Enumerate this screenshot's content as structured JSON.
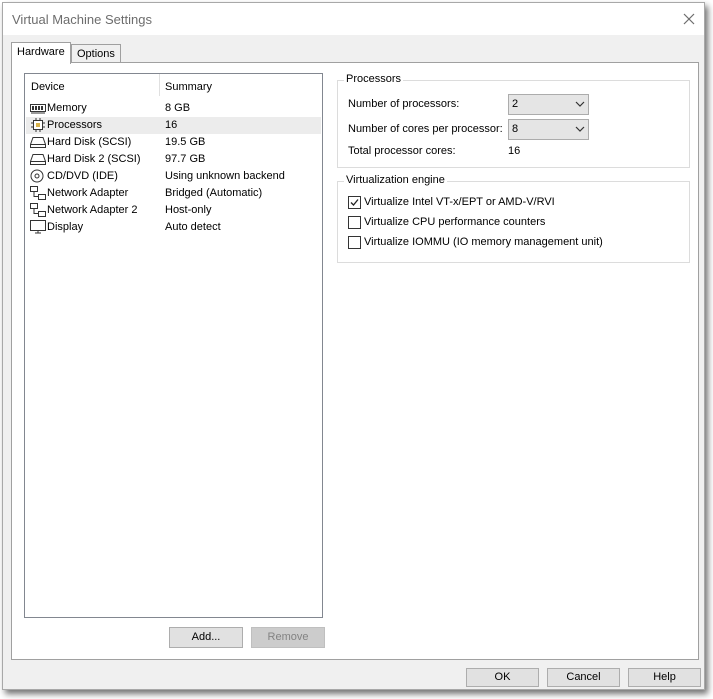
{
  "window": {
    "title": "Virtual Machine Settings"
  },
  "tabs": [
    {
      "label": "Hardware",
      "active": true
    },
    {
      "label": "Options",
      "active": false
    }
  ],
  "device_list": {
    "headers": {
      "device": "Device",
      "summary": "Summary"
    },
    "items": [
      {
        "icon": "memory-icon",
        "name": "Memory",
        "summary": "8 GB"
      },
      {
        "icon": "processor-icon",
        "name": "Processors",
        "summary": "16",
        "selected": true
      },
      {
        "icon": "hard-disk-icon",
        "name": "Hard Disk (SCSI)",
        "summary": "19.5 GB"
      },
      {
        "icon": "hard-disk-icon",
        "name": "Hard Disk 2 (SCSI)",
        "summary": "97.7 GB"
      },
      {
        "icon": "cd-dvd-icon",
        "name": "CD/DVD (IDE)",
        "summary": "Using unknown backend"
      },
      {
        "icon": "network-adapter-icon",
        "name": "Network Adapter",
        "summary": "Bridged (Automatic)"
      },
      {
        "icon": "network-adapter-icon",
        "name": "Network Adapter 2",
        "summary": "Host-only"
      },
      {
        "icon": "display-icon",
        "name": "Display",
        "summary": "Auto detect"
      }
    ],
    "add_label": "Add...",
    "remove_label": "Remove"
  },
  "processors": {
    "group_title": "Processors",
    "num_processors_label": "Number of processors:",
    "num_processors_value": "2",
    "cores_label": "Number of cores per processor:",
    "cores_value": "8",
    "total_label": "Total processor cores:",
    "total_value": "16"
  },
  "virtualization": {
    "group_title": "Virtualization engine",
    "options": [
      {
        "label": "Virtualize Intel VT-x/EPT or AMD-V/RVI",
        "checked": true
      },
      {
        "label": "Virtualize CPU performance counters",
        "checked": false
      },
      {
        "label": "Virtualize IOMMU (IO memory management unit)",
        "checked": false
      }
    ]
  },
  "footer": {
    "ok_label": "OK",
    "cancel_label": "Cancel",
    "help_label": "Help"
  }
}
